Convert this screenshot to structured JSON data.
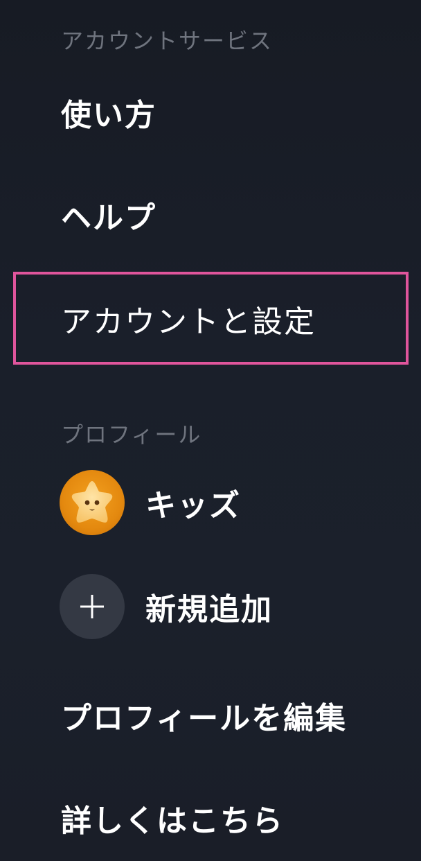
{
  "account_services": {
    "header": "アカウントサービス",
    "items": [
      {
        "label": "使い方"
      },
      {
        "label": "ヘルプ"
      },
      {
        "label": "アカウントと設定"
      }
    ]
  },
  "profiles": {
    "header": "プロフィール",
    "items": [
      {
        "label": "キッズ",
        "avatar_icon": "star-face-icon"
      },
      {
        "label": "新規追加",
        "avatar_icon": "plus-icon"
      }
    ]
  },
  "footer_items": [
    {
      "label": "プロフィールを編集"
    },
    {
      "label": "詳しくはこちら"
    }
  ],
  "colors": {
    "background": "#191e28",
    "section_header": "#6f747e",
    "highlight": "#e0559c",
    "kids_avatar": "#e4890f",
    "add_avatar": "#343944"
  }
}
